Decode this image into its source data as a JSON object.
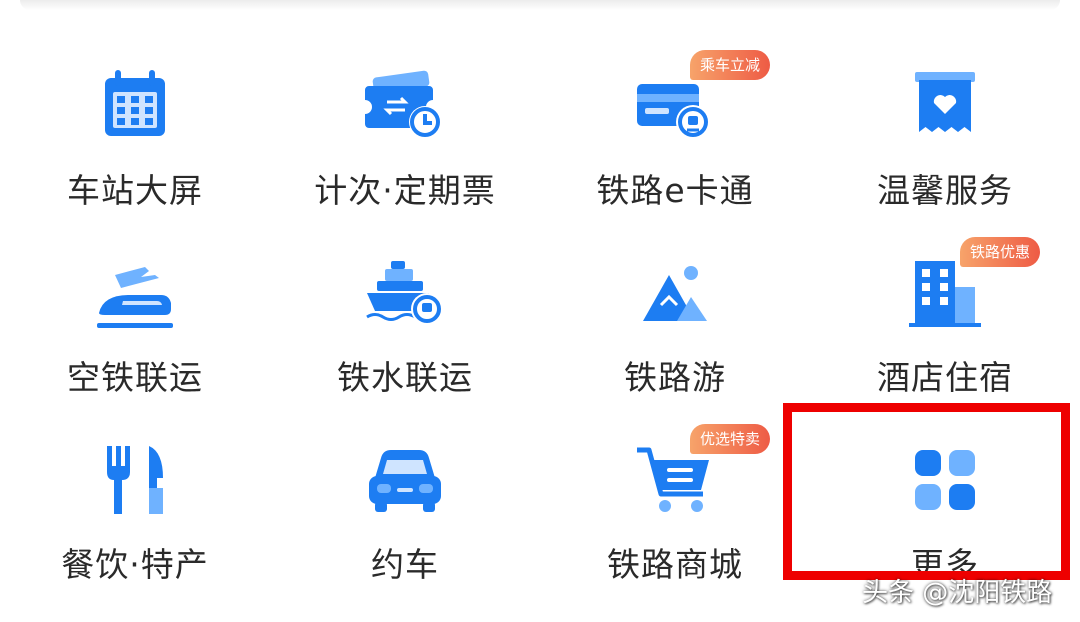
{
  "colors": {
    "primary": "#1d7df2",
    "light": "#6fb2ff",
    "badge": "#ee5b45",
    "highlight": "#ee0000"
  },
  "services": [
    {
      "label": "车站大屏",
      "icon": "calendar-grid-icon",
      "badge": ""
    },
    {
      "label": "计次·定期票",
      "icon": "ticket-clock-icon",
      "badge": ""
    },
    {
      "label": "铁路e卡通",
      "icon": "card-train-icon",
      "badge": "乘车立减"
    },
    {
      "label": "温馨服务",
      "icon": "heart-ticket-icon",
      "badge": ""
    },
    {
      "label": "空铁联运",
      "icon": "plane-train-icon",
      "badge": ""
    },
    {
      "label": "铁水联运",
      "icon": "ship-train-icon",
      "badge": ""
    },
    {
      "label": "铁路游",
      "icon": "mountain-icon",
      "badge": ""
    },
    {
      "label": "酒店住宿",
      "icon": "hotel-building-icon",
      "badge": "铁路优惠"
    },
    {
      "label": "餐饮·特产",
      "icon": "fork-knife-icon",
      "badge": ""
    },
    {
      "label": "约车",
      "icon": "car-icon",
      "badge": ""
    },
    {
      "label": "铁路商城",
      "icon": "shopping-cart-icon",
      "badge": "优选特卖"
    },
    {
      "label": "更多",
      "icon": "more-apps-icon",
      "badge": ""
    }
  ],
  "watermark": "头条 @沈阳铁路"
}
